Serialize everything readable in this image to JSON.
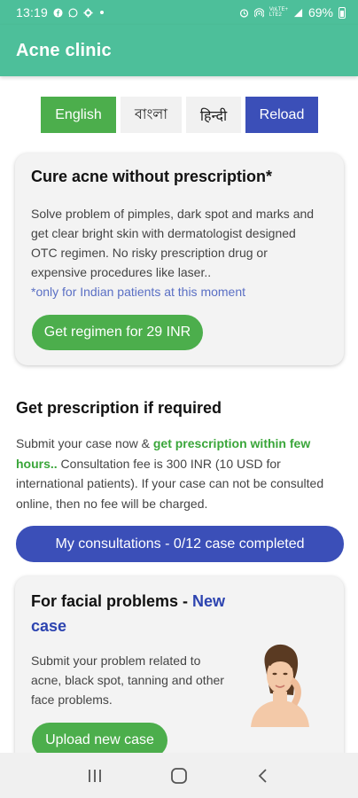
{
  "status_bar": {
    "time": "13:19",
    "network_top": "VoLTE+",
    "network_bottom": "LTE2",
    "battery": "69%"
  },
  "app_bar": {
    "title": "Acne clinic"
  },
  "languages": {
    "english": "English",
    "bangla": "বাংলা",
    "hindi": "हिन्दी",
    "reload": "Reload"
  },
  "otc_card": {
    "title": "Cure acne without prescription*",
    "description": "Solve problem of pimples, dark spot and marks and get clear bright skin with dermatologist designed OTC regimen. No risky prescription drug or expensive procedures like laser..",
    "note": "*only for Indian patients at this moment",
    "button": "Get regimen for 29 INR"
  },
  "prescription": {
    "title": "Get prescription if required",
    "text_prefix": "Submit your case now & ",
    "text_highlight": "get prescription within few hours..",
    "text_suffix": " Consultation fee is 300 INR (10 USD for international patients). If your case can not be consulted online, then no fee will be charged.",
    "consultations_button": "My consultations - 0/12 case completed"
  },
  "facial_card": {
    "title_prefix": "For facial problems - ",
    "title_highlight": "New case",
    "description": "Submit your problem related to acne, black spot, tanning and other face problems.",
    "button": "Upload new case"
  },
  "colors": {
    "app_bar": "#4dbf9a",
    "green_button": "#4cae4c",
    "blue_button": "#3b4fb8",
    "highlight_green": "#3aa63a",
    "note_blue": "#5a6fc4"
  }
}
